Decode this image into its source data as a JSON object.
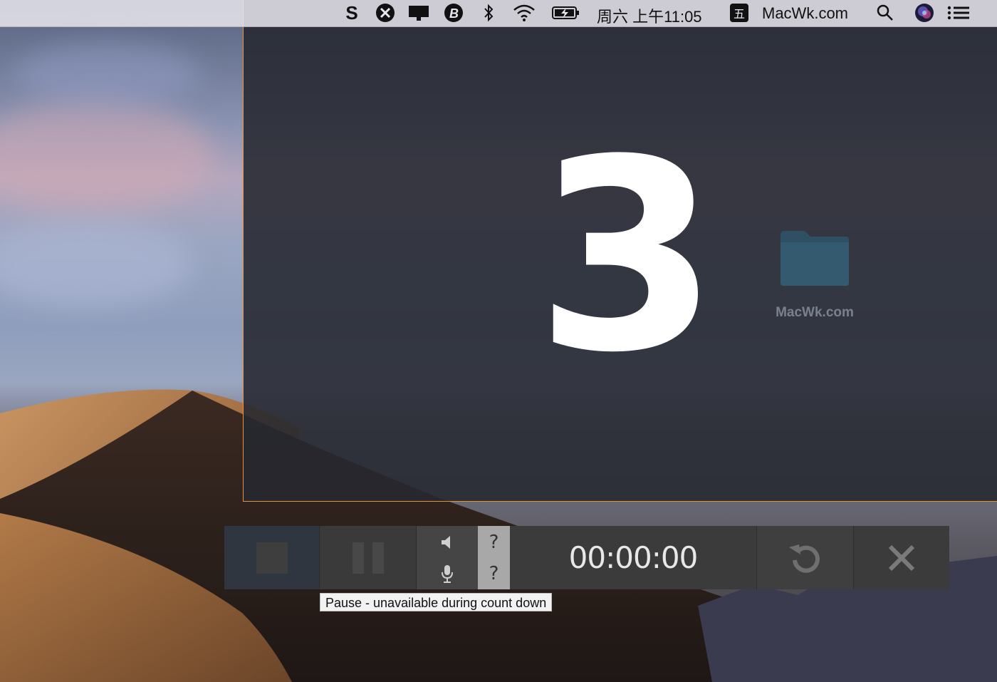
{
  "menubar": {
    "icons": [
      "s-app-icon",
      "scissors-icon",
      "display-icon",
      "bitcoin-icon",
      "bluetooth-icon",
      "wifi-icon",
      "battery-charging-icon",
      "input-method-icon",
      "search-icon",
      "siri-icon",
      "notification-center-icon"
    ],
    "clock": "周六 上午11:05",
    "input_method": "五",
    "brand": "MacWk.com"
  },
  "capture": {
    "countdown": "3",
    "border_color": "#e8913a"
  },
  "desktop": {
    "folder_label": "MacWk.com"
  },
  "toolbar": {
    "timer": "00:00:00",
    "speaker_status": "?",
    "mic_status": "?",
    "buttons": [
      "stop-button",
      "pause-button",
      "speaker-toggle",
      "microphone-toggle",
      "restart-button",
      "close-button"
    ]
  },
  "tooltip": {
    "text": "Pause - unavailable during count down"
  }
}
